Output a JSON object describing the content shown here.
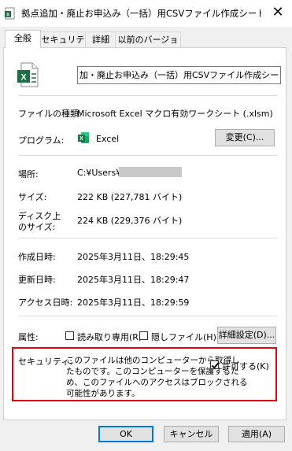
{
  "window": {
    "title": "拠点追加・廃止お申込み（一括）用CSVファイル作成シート.xlsmのプロ…",
    "close_icon": "close-icon"
  },
  "tabs": [
    "全般",
    "セキュリティ",
    "詳細",
    "以前のバージョン"
  ],
  "general": {
    "file_name": "加・廃止お申込み（一括）用CSVファイル作成シート.xlsm",
    "file_type_label": "ファイルの種類:",
    "file_type_value": "Microsoft Excel マクロ有効ワークシート (.xlsm)",
    "program_label": "プログラム:",
    "program_value": "Excel",
    "change_button": "変更(C)...",
    "location_label": "場所:",
    "location_value": "C:¥Users¥",
    "size_label": "サイズ:",
    "size_value": "222 KB (227,781 バイト)",
    "disk_size_label_line1": "ディスク上",
    "disk_size_label_line2": "のサイズ:",
    "disk_size_value": "224 KB (229,376 バイト)",
    "created_label": "作成日時:",
    "created_value": "2025年3月11日、18:29:45",
    "modified_label": "更新日時:",
    "modified_value": "2025年3月11日、18:29:47",
    "accessed_label": "アクセス日時:",
    "accessed_value": "2025年3月11日、18:29:59",
    "attributes_label": "属性:",
    "readonly_label": "読み取り専用(R)",
    "hidden_label": "隠しファイル(H)",
    "advanced_button": "詳細設定(D)...",
    "security_label": "セキュリティ:",
    "security_text_lines": [
      "このファイルは他のコンピューターから取得し",
      "たものです。このコンピューターを保護するた",
      "め、このファイルへのアクセスはブロックされる",
      "可能性があります。"
    ],
    "unblock_label": "許可する(K)",
    "unblock_checked": true,
    "readonly_checked": false,
    "hidden_checked": false
  },
  "footer": {
    "ok": "OK",
    "cancel": "キャンセル",
    "apply": "適用(A)"
  },
  "colors": {
    "excel_green": "#1d6f42",
    "highlight_red": "#e60012",
    "accent_blue": "#0078d7"
  }
}
